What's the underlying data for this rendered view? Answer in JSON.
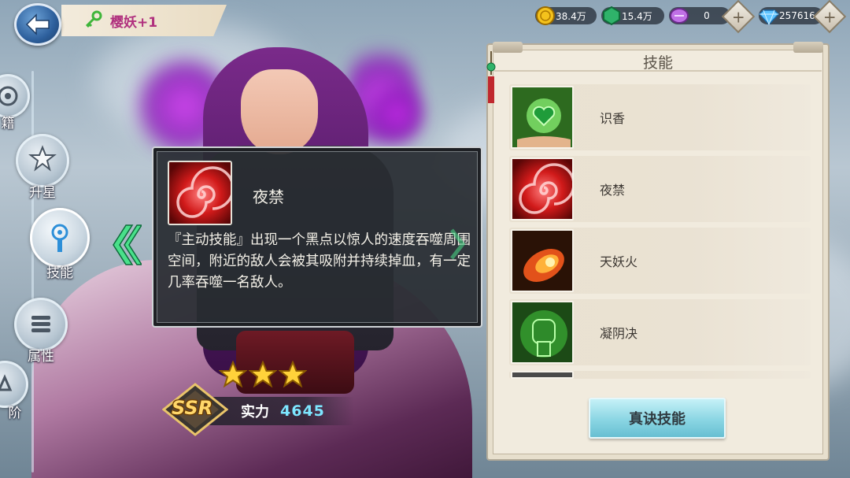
{
  "header": {
    "character_title": "樱妖+1"
  },
  "resources": [
    {
      "icon": "gold-coin-icon",
      "value": "38.4万"
    },
    {
      "icon": "green-jade-icon",
      "value": "15.4万"
    },
    {
      "icon": "purple-crystal-icon",
      "value": "0"
    },
    {
      "icon": "diamond-icon",
      "value": "257616"
    }
  ],
  "side_nav": {
    "items": [
      {
        "label": "籍",
        "icon": "book-icon"
      },
      {
        "label": "升星",
        "icon": "star-upgrade-icon"
      },
      {
        "label": "技能",
        "icon": "skill-icon",
        "active": true
      },
      {
        "label": "属性",
        "icon": "attributes-icon"
      },
      {
        "label": "阶",
        "icon": "rank-icon"
      }
    ]
  },
  "tooltip": {
    "skill_name": "夜禁",
    "description": "『主动技能』出现一个黑点以惊人的速度吞噬周围空间，附近的敌人会被其吸附并持续掉血，有一定几率吞噬一名敌人。"
  },
  "hero": {
    "rarity": "SSR",
    "stars": 3,
    "power_label": "实力",
    "power_value": "4645"
  },
  "skills_panel": {
    "title": "技能",
    "skills": [
      {
        "name": "识香",
        "icon": "heart-orb-icon"
      },
      {
        "name": "夜禁",
        "icon": "red-vortex-icon"
      },
      {
        "name": "天妖火",
        "icon": "fireball-icon"
      },
      {
        "name": "凝阴决",
        "icon": "green-fist-icon"
      }
    ],
    "true_skill_button": "真诀技能"
  },
  "colors": {
    "title_text": "#b0307e",
    "power_value": "#7de6ff",
    "panel_bg": "#f1ebde",
    "button_cyan": "#8ad5e3"
  }
}
